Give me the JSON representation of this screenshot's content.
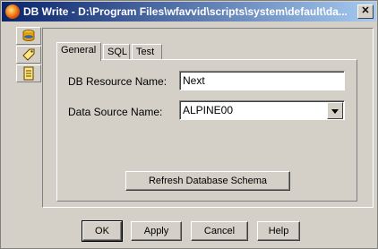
{
  "window": {
    "title": "DB Write - D:\\Program Files\\wfavvid\\scripts\\system\\default\\da..."
  },
  "sidebar": {
    "items": [
      {
        "icon": "database-icon"
      },
      {
        "icon": "tag-icon"
      },
      {
        "icon": "notes-icon"
      }
    ]
  },
  "tabs": [
    {
      "label": "General",
      "active": true
    },
    {
      "label": "SQL",
      "active": false
    },
    {
      "label": "Test",
      "active": false
    }
  ],
  "form": {
    "db_resource_label": "DB Resource Name:",
    "db_resource_value": "Next",
    "data_source_label": "Data Source Name:",
    "data_source_value": "ALPINE00",
    "refresh_label": "Refresh Database Schema"
  },
  "buttons": {
    "ok": "OK",
    "apply": "Apply",
    "cancel": "Cancel",
    "help": "Help"
  }
}
